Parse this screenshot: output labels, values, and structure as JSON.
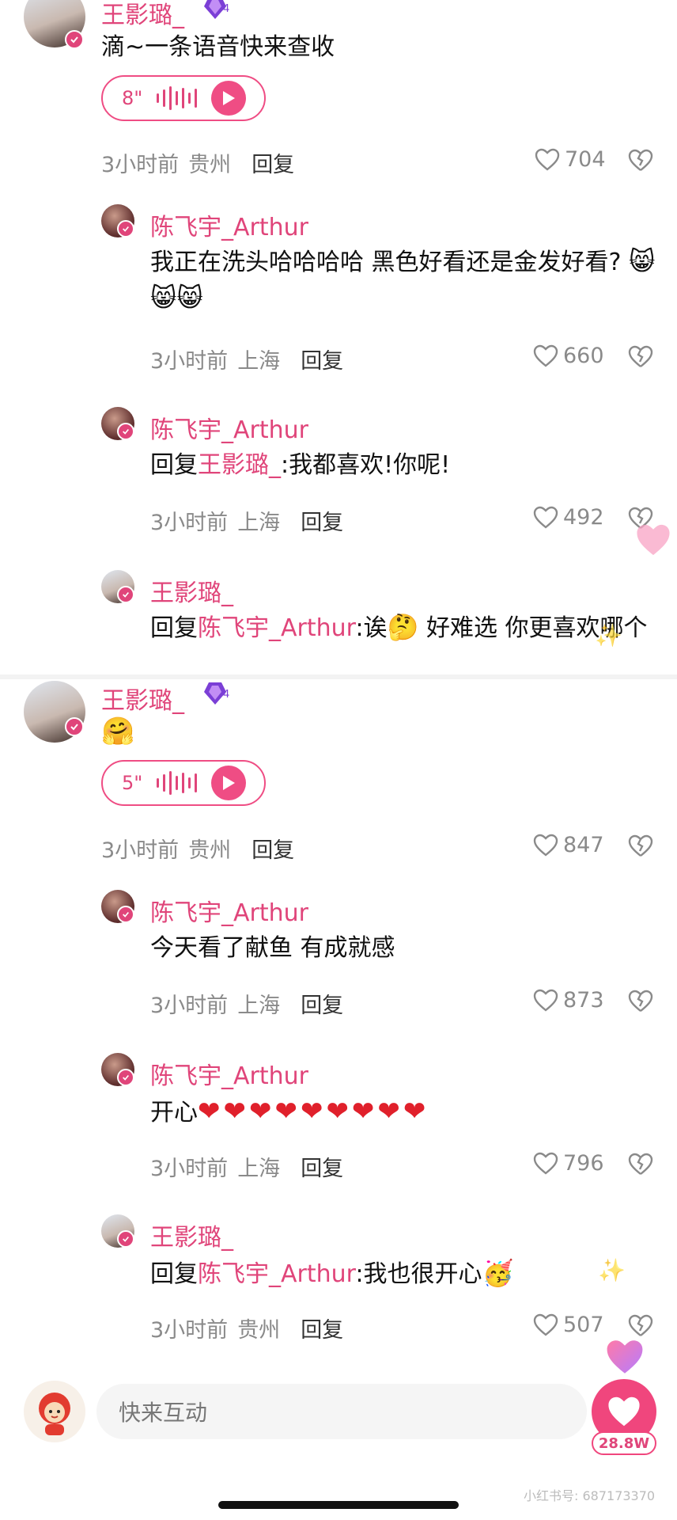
{
  "threads": [
    {
      "comment": {
        "author": "王影璐_",
        "level": "4",
        "text": "滴~一条语音快来查收",
        "voice": {
          "duration": "8\""
        },
        "meta": {
          "time": "3小时前",
          "location": "贵州",
          "reply": "回复"
        },
        "likes": "704"
      },
      "replies": [
        {
          "author": "陈飞宇_Arthur",
          "text": "我正在洗头哈哈哈哈  黑色好看还是金发好看?",
          "meta": {
            "time": "3小时前",
            "location": "上海",
            "reply": "回复"
          },
          "likes": "660"
        },
        {
          "author": "陈飞宇_Arthur",
          "reply_prefix": "回复",
          "mention": "王影璐_",
          "text": ":我都喜欢!你呢!",
          "meta": {
            "time": "3小时前",
            "location": "上海",
            "reply": "回复"
          },
          "likes": "492"
        },
        {
          "author": "王影璐_",
          "reply_prefix": "回复",
          "mention": "陈飞宇_Arthur",
          "text": ":诶",
          "text2": "好难选 你更喜欢哪个"
        }
      ]
    },
    {
      "comment": {
        "author": "王影璐_",
        "level": "4",
        "voice": {
          "duration": "5\""
        },
        "meta": {
          "time": "3小时前",
          "location": "贵州",
          "reply": "回复"
        },
        "likes": "847"
      },
      "replies": [
        {
          "author": "陈飞宇_Arthur",
          "text": "今天看了献鱼 有成就感",
          "meta": {
            "time": "3小时前",
            "location": "上海",
            "reply": "回复"
          },
          "likes": "873"
        },
        {
          "author": "陈飞宇_Arthur",
          "text": "开心",
          "meta": {
            "time": "3小时前",
            "location": "上海",
            "reply": "回复"
          },
          "likes": "796"
        },
        {
          "author": "王影璐_",
          "reply_prefix": "回复",
          "mention": "陈飞宇_Arthur",
          "text": ":我也很开心",
          "meta": {
            "time": "3小时前",
            "location": "贵州",
            "reply": "回复"
          },
          "likes": "507"
        }
      ]
    }
  ],
  "bottom": {
    "input_placeholder": "快来互动",
    "like_count": "28.8W"
  },
  "watermark": "小红书号: 687173370",
  "colors": {
    "accent": "#e0457a",
    "pink_button": "#f0467d",
    "meta_gray": "#8a8a8a"
  }
}
